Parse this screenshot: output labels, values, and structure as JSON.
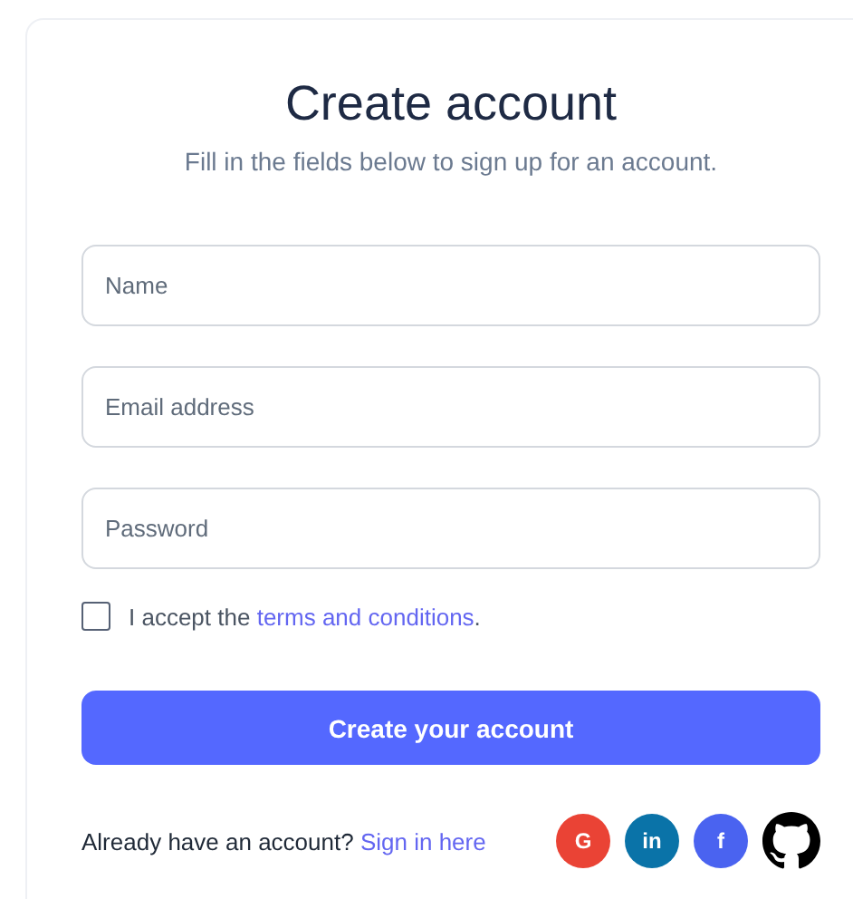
{
  "title": "Create account",
  "subtitle": "Fill in the fields below to sign up for an account.",
  "fields": [
    {
      "placeholder": "Name"
    },
    {
      "placeholder": "Email address"
    },
    {
      "placeholder": "Password"
    }
  ],
  "terms": {
    "checked": false,
    "text": "I accept the",
    "link": "terms and conditions",
    "end": "."
  },
  "submit": "Create your account",
  "footer": {
    "text": "Already have an account?",
    "link": "Sign in here"
  },
  "social": [
    {
      "kind": "google",
      "label": "G",
      "color": "#ea4335"
    },
    {
      "kind": "linkedin",
      "label": "in",
      "color": "#0a73a8"
    },
    {
      "kind": "facebook",
      "label": "f",
      "color": "#4a63f0"
    },
    {
      "kind": "github"
    }
  ]
}
